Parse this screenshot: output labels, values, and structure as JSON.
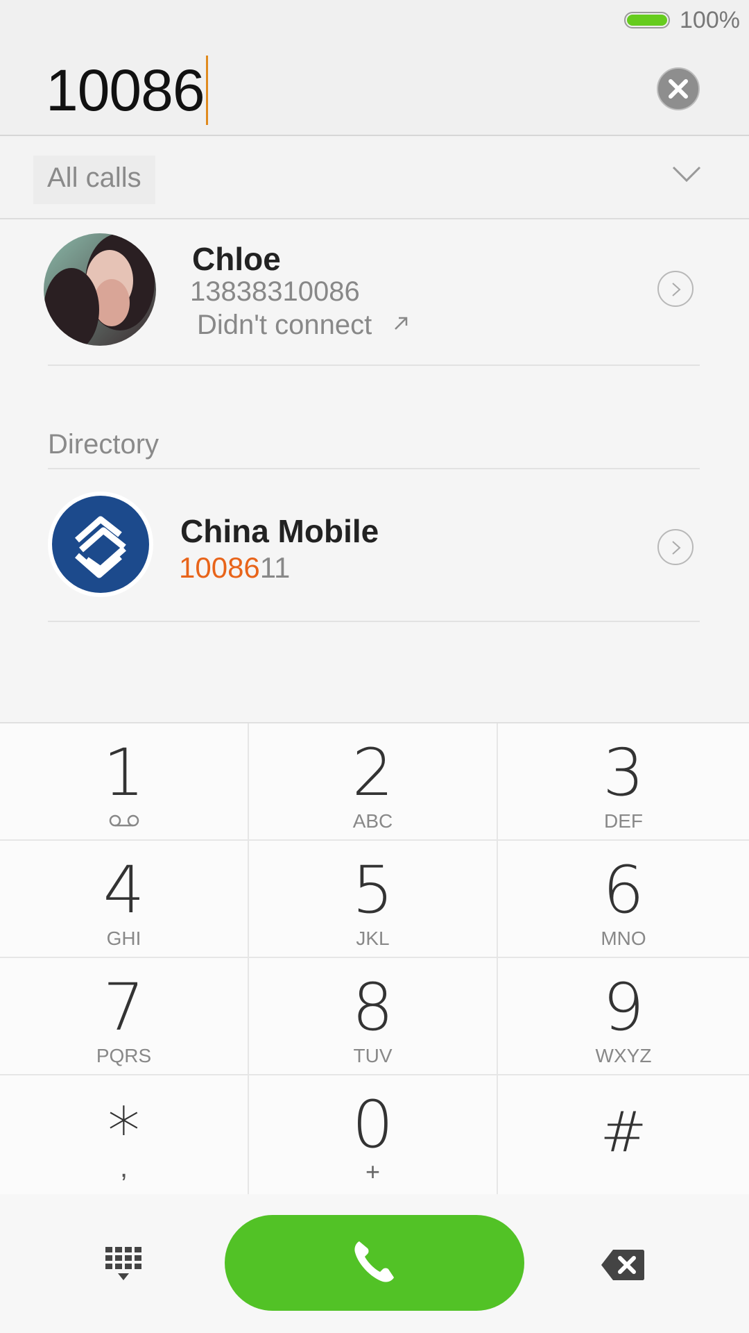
{
  "status": {
    "battery_text": "100%",
    "battery_level": 1.0
  },
  "dial": {
    "number": "10086"
  },
  "filter": {
    "label": "All calls"
  },
  "calls": [
    {
      "name": "Chloe",
      "number": "13838310086",
      "status": "Didn't connect",
      "direction": "outgoing-arrow-icon"
    }
  ],
  "directory": {
    "title": "Directory",
    "entries": [
      {
        "name": "China Mobile",
        "number_match": "10086",
        "number_rest": "11"
      }
    ]
  },
  "keypad": [
    {
      "digit": "1",
      "letters": ""
    },
    {
      "digit": "2",
      "letters": "ABC"
    },
    {
      "digit": "3",
      "letters": "DEF"
    },
    {
      "digit": "4",
      "letters": "GHI"
    },
    {
      "digit": "5",
      "letters": "JKL"
    },
    {
      "digit": "6",
      "letters": "MNO"
    },
    {
      "digit": "7",
      "letters": "PQRS"
    },
    {
      "digit": "8",
      "letters": "TUV"
    },
    {
      "digit": "9",
      "letters": "WXYZ"
    },
    {
      "digit": "*",
      "letters": ","
    },
    {
      "digit": "0",
      "letters": "+"
    },
    {
      "digit": "#",
      "letters": ""
    }
  ],
  "colors": {
    "call_green": "#52c226",
    "match_orange": "#e8641a",
    "battery_green": "#66cc1e"
  }
}
